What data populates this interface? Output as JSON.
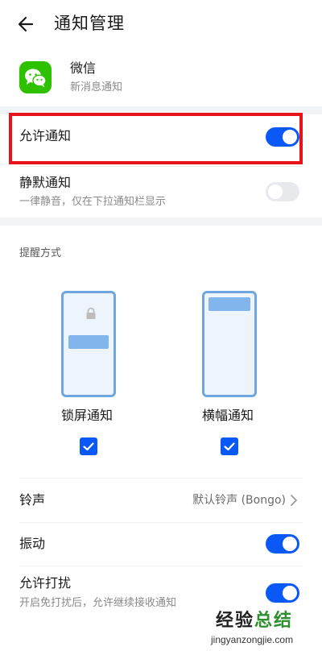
{
  "header": {
    "title": "通知管理"
  },
  "app": {
    "name": "微信",
    "subtitle": "新消息通知"
  },
  "allow": {
    "label": "允许通知",
    "on": true
  },
  "silent": {
    "label": "静默通知",
    "subtitle": "一律静音，仅在下拉通知栏显示",
    "on": false
  },
  "style": {
    "section_label": "提醒方式",
    "lock_label": "锁屏通知",
    "lock_checked": true,
    "banner_label": "横幅通知",
    "banner_checked": true
  },
  "ringtone": {
    "label": "铃声",
    "value": "默认铃声 (Bongo)"
  },
  "vibrate": {
    "label": "振动",
    "on": true
  },
  "dnd": {
    "label": "允许打扰",
    "subtitle": "开启免打扰后，允许继续接收通知",
    "on": true
  },
  "watermark": {
    "brand_1": "经验",
    "brand_2": "总结",
    "url": "jingyanzongjie.com"
  },
  "colors": {
    "accent": "#0a59f7",
    "highlight": "#e8131a",
    "wechat": "#2dc100"
  }
}
